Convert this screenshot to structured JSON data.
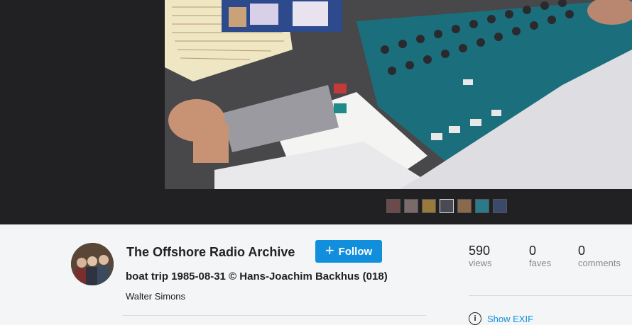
{
  "owner": {
    "name": "The Offshore Radio Archive"
  },
  "follow": {
    "label": "Follow"
  },
  "photo": {
    "title": "boat trip 1985-08-31 © Hans-Joachim Backhus (018)",
    "description": "Walter Simons"
  },
  "stats": [
    {
      "value": "590",
      "label": "views"
    },
    {
      "value": "0",
      "label": "faves"
    },
    {
      "value": "0",
      "label": "comments"
    }
  ],
  "exif": {
    "label": "Show EXIF"
  },
  "colors": {
    "accent": "#128fdc",
    "viewer_bg": "#212124",
    "page_bg": "#f3f5f6"
  }
}
